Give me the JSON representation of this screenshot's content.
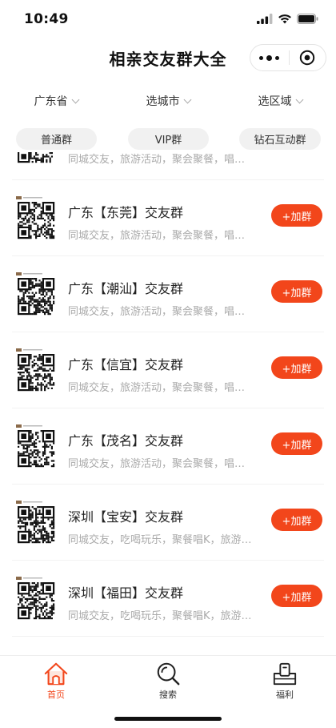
{
  "status_bar": {
    "time": "10:49"
  },
  "header": {
    "title": "相亲交友群大全"
  },
  "filters": [
    {
      "label": "广东省"
    },
    {
      "label": "选城市"
    },
    {
      "label": "选区域"
    }
  ],
  "categories": [
    {
      "label": "普通群"
    },
    {
      "label": "VIP群"
    },
    {
      "label": "钻石互动群"
    }
  ],
  "groups": [
    {
      "title": "",
      "desc": "同城交友，旅游活动，聚会聚餐，唱歌k吧",
      "button": "+加群"
    },
    {
      "title": "广东【东莞】交友群",
      "desc": "同城交友，旅游活动，聚会聚餐，唱歌k吧",
      "button": "+加群"
    },
    {
      "title": "广东【潮汕】交友群",
      "desc": "同城交友，旅游活动，聚会聚餐，唱歌k吧",
      "button": "+加群"
    },
    {
      "title": "广东【信宜】交友群",
      "desc": "同城交友，旅游活动，聚会聚餐，唱歌k吧",
      "button": "+加群"
    },
    {
      "title": "广东【茂名】交友群",
      "desc": "同城交友，旅游活动，聚会聚餐，唱歌k吧",
      "button": "+加群"
    },
    {
      "title": "深圳【宝安】交友群",
      "desc": "同城交友，吃喝玩乐，聚餐唱K，旅游户…",
      "button": "+加群"
    },
    {
      "title": "深圳【福田】交友群",
      "desc": "同城交友，吃喝玩乐，聚餐唱K，旅游户外",
      "button": "+加群"
    }
  ],
  "tabbar": {
    "items": [
      {
        "label": "首页",
        "icon": "home-icon",
        "active": true
      },
      {
        "label": "搜索",
        "icon": "search-icon",
        "active": false
      },
      {
        "label": "福利",
        "icon": "gift-icon",
        "active": false
      }
    ]
  },
  "colors": {
    "accent": "#f2461b",
    "muted_text": "#aaaaaa",
    "pill_bg": "#f1f1f1"
  }
}
